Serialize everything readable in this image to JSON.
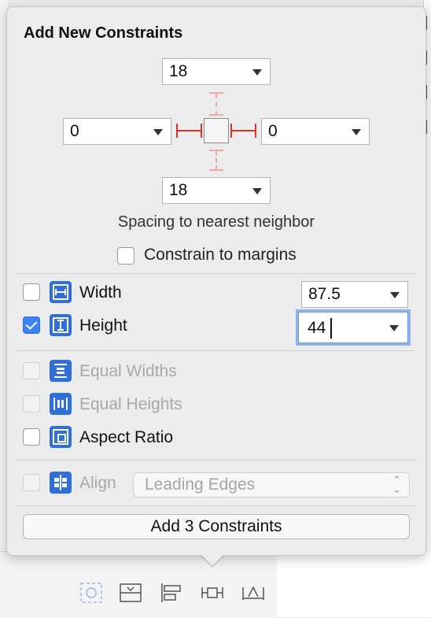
{
  "popover": {
    "title": "Add New Constraints",
    "spacing": {
      "top": "18",
      "left": "0",
      "right": "0",
      "bottom": "18",
      "caption": "Spacing to nearest neighbor"
    },
    "constrain_to_margins": {
      "label": "Constrain to margins",
      "checked": false
    },
    "width": {
      "label": "Width",
      "value": "87.5",
      "checked": false
    },
    "height": {
      "label": "Height",
      "value": "44",
      "checked": true
    },
    "equal_widths": {
      "label": "Equal Widths",
      "enabled": false
    },
    "equal_heights": {
      "label": "Equal Heights",
      "enabled": false
    },
    "aspect_ratio": {
      "label": "Aspect Ratio",
      "checked": false
    },
    "align": {
      "label": "Align",
      "value": "Leading Edges",
      "enabled": false
    },
    "add_button": "Add 3 Constraints"
  },
  "bottom_toolbar": {
    "icons": [
      "update-frames-icon",
      "stack-icon",
      "align-icon",
      "pin-icon",
      "resolve-issues-icon"
    ]
  },
  "colors": {
    "accent": "#2f6fd9",
    "strut_active": "#d9352c",
    "strut_inactive": "#f2a7a2"
  }
}
